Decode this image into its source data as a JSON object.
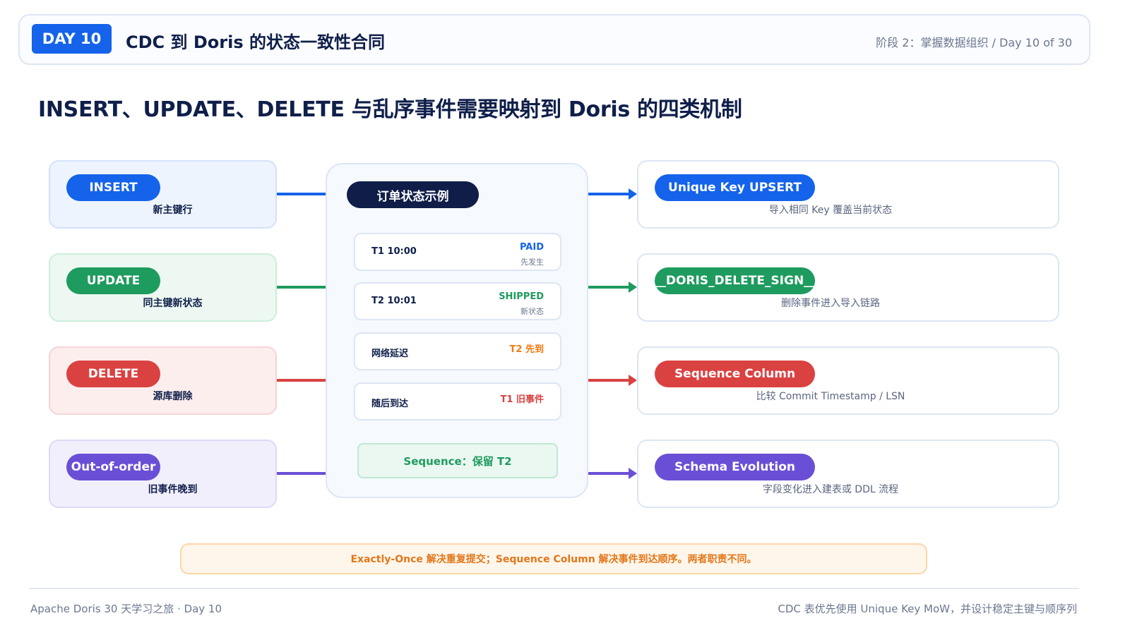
{
  "header": {
    "badge": "DAY 10",
    "title": "CDC 到 Doris 的状态一致性合同",
    "meta": "阶段 2：掌握数据组织 / Day 10 of 30"
  },
  "heading": "INSERT、UPDATE、DELETE 与乱序事件需要映射到 Doris 的四类机制",
  "events": [
    {
      "label": "INSERT",
      "sub": "新主键行",
      "color": "#1463ea",
      "bg": "#eef4fe",
      "border": "#d3e2fb"
    },
    {
      "label": "UPDATE",
      "sub": "同主键新状态",
      "color": "#1e9b5e",
      "bg": "#ecf8f1",
      "border": "#cdeedb"
    },
    {
      "label": "DELETE",
      "sub": "源库删除",
      "color": "#da4141",
      "bg": "#fdeeee",
      "border": "#f6d4d4"
    },
    {
      "label": "Out-of-order",
      "sub": "旧事件晚到",
      "color": "#6a4fd6",
      "bg": "#f2effd",
      "border": "#e0d8f8"
    }
  ],
  "center": {
    "title": "订单状态示例",
    "rows": [
      {
        "time": "T1 10:00",
        "status": "PAID",
        "note": "先发生",
        "color": "#1463ea"
      },
      {
        "time": "T2 10:01",
        "status": "SHIPPED",
        "note": "新状态",
        "color": "#1e9b5e"
      },
      {
        "time": "网络延迟",
        "status": "T2 先到",
        "note": "",
        "color": "#ee7a12"
      },
      {
        "time": "随后到达",
        "status": "T1 旧事件",
        "note": "",
        "color": "#da4141"
      }
    ],
    "sequence_result": "Sequence：保留 T2"
  },
  "mechanisms": [
    {
      "label": "Unique Key UPSERT",
      "sub": "导入相同 Key 覆盖当前状态",
      "color": "#1463ea"
    },
    {
      "label": "__DORIS_DELETE_SIGN__",
      "sub": "删除事件进入导入链路",
      "color": "#1e9b5e"
    },
    {
      "label": "Sequence Column",
      "sub": "比较 Commit Timestamp / LSN",
      "color": "#da4141"
    },
    {
      "label": "Schema Evolution",
      "sub": "字段变化进入建表或 DDL 流程",
      "color": "#6a4fd6"
    }
  ],
  "note": "Exactly-Once 解决重复提交；Sequence Column 解决事件到达顺序。两者职责不同。",
  "footer": {
    "left": "Apache Doris 30 天学习之旅 · Day 10",
    "right": "CDC 表优先使用 Unique Key MoW，并设计稳定主键与顺序列"
  }
}
